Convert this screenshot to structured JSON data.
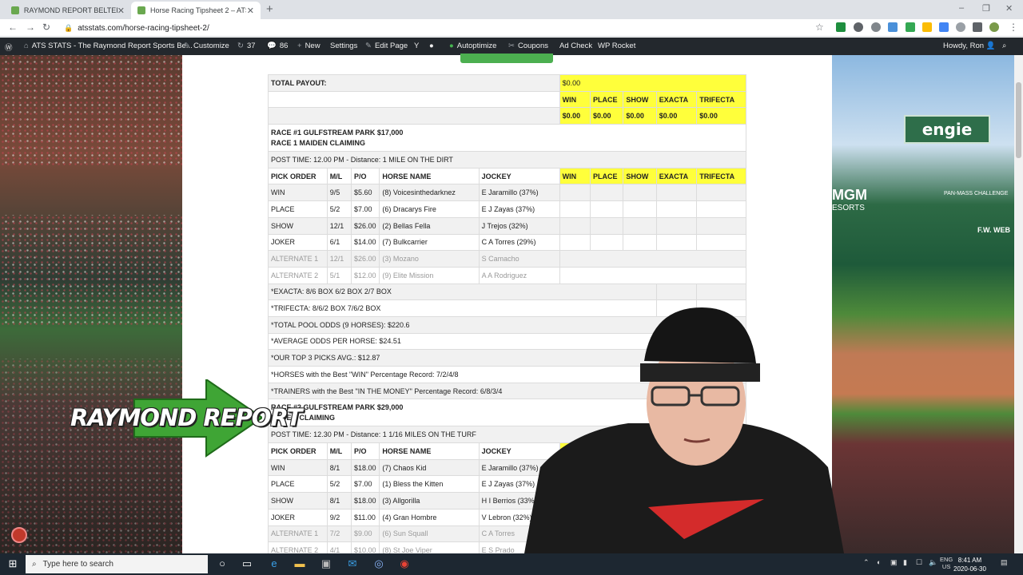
{
  "browser": {
    "tabs": [
      {
        "title": "RAYMOND REPORT BELTERRA PA",
        "active": false
      },
      {
        "title": "Horse Racing Tipsheet 2 – ATS ST",
        "active": true
      }
    ],
    "new_tab_label": "+",
    "url": "atsstats.com/horse-racing-tipsheet-2/",
    "nav_icons": [
      "back-icon",
      "forward-icon",
      "reload-icon",
      "lock-icon"
    ]
  },
  "wp_admin": {
    "site": "ATS STATS - The Raymond Report Sports Be...",
    "customize": "Customize",
    "updates": "37",
    "comments": "86",
    "new": "New",
    "settings": "Settings",
    "edit_page": "Edit Page",
    "autoptimize": "Autoptimize",
    "coupons": "Coupons",
    "ad_check": "Ad Check",
    "wp_rocket": "WP Rocket",
    "howdy": "Howdy, Ron"
  },
  "tipsheet": {
    "total_payout_label": "TOTAL PAYOUT:",
    "total_payout_value": "$0.00",
    "bet_types": [
      "WIN",
      "PLACE",
      "SHOW",
      "EXACTA",
      "TRIFECTA"
    ],
    "bet_totals": [
      "$0.00",
      "$0.00",
      "$0.00",
      "$0.00",
      "$0.00"
    ],
    "col_headers": [
      "PICK ORDER",
      "M/L",
      "P/O",
      "HORSE NAME",
      "JOCKEY"
    ],
    "race1": {
      "title": "RACE #1 GULFSTREAM PARK $17,000",
      "subtitle": "RACE 1 MAIDEN CLAIMING",
      "post_time": "POST TIME: 12.00 PM - Distance: 1 MILE ON THE DIRT",
      "picks": [
        {
          "order": "WIN",
          "ml": "9/5",
          "po": "$5.60",
          "horse": "(8) Voicesinthedarknez",
          "jockey": "E Jaramillo (37%)"
        },
        {
          "order": "PLACE",
          "ml": "5/2",
          "po": "$7.00",
          "horse": "(6) Dracarys Fire",
          "jockey": "E J Zayas (37%)"
        },
        {
          "order": "SHOW",
          "ml": "12/1",
          "po": "$26.00",
          "horse": "(2) Bellas Fella",
          "jockey": "J Trejos (32%)"
        },
        {
          "order": "JOKER",
          "ml": "6/1",
          "po": "$14.00",
          "horse": "(7) Bulkcarrier",
          "jockey": "C A Torres (29%)"
        }
      ],
      "alternates": [
        {
          "order": "ALTERNATE 1",
          "ml": "12/1",
          "po": "$26.00",
          "horse": "(3) Mozano",
          "jockey": "S Camacho"
        },
        {
          "order": "ALTERNATE 2",
          "ml": "5/1",
          "po": "$12.00",
          "horse": "(9) Elite Mission",
          "jockey": "A A Rodriguez"
        }
      ],
      "notes": [
        "*EXACTA: 8/6 BOX 6/2 BOX 2/7 BOX",
        "*TRIFECTA: 8/6/2 BOX 7/6/2 BOX",
        "*TOTAL POOL ODDS (9 HORSES): $220.6",
        "*AVERAGE ODDS PER HORSE: $24.51",
        "*OUR TOP 3 PICKS AVG.: $12.87",
        "*HORSES with the Best \"WIN\" Percentage Record: 7/2/4/8",
        "*TRAINERS with the Best \"IN THE MONEY\" Percentage Record: 6/8/3/4"
      ]
    },
    "race2": {
      "title": "RACE #2 GULFSTREAM PARK $29,000",
      "subtitle": "RACE 2 CLAIMING",
      "post_time": "POST TIME: 12.30 PM - Distance: 1 1/16 MILES ON THE TURF",
      "win_header": "WIN",
      "picks": [
        {
          "order": "WIN",
          "ml": "8/1",
          "po": "$18.00",
          "horse": "(7) Chaos Kid",
          "jockey": "E Jaramillo (37%)"
        },
        {
          "order": "PLACE",
          "ml": "5/2",
          "po": "$7.00",
          "horse": "(1) Bless the Kitten",
          "jockey": "E J Zayas (37%)"
        },
        {
          "order": "SHOW",
          "ml": "8/1",
          "po": "$18.00",
          "horse": "(3) Allgorilla",
          "jockey": "H I Berrios (33%)"
        },
        {
          "order": "JOKER",
          "ml": "9/2",
          "po": "$11.00",
          "horse": "(4) Gran Hombre",
          "jockey": "V Lebron (32%)"
        }
      ],
      "alternates": [
        {
          "order": "ALTERNATE 1",
          "ml": "7/2",
          "po": "$9.00",
          "horse": "(6) Sun Squall",
          "jockey": "C A Torres"
        },
        {
          "order": "ALTERNATE 2",
          "ml": "4/1",
          "po": "$10.00",
          "horse": "(8) St Joe Viper",
          "jockey": "E S Prado"
        }
      ]
    }
  },
  "overlay": {
    "logo_text": "RAYMOND REPORT",
    "stadium_sign": "engie",
    "mgm": "MGM",
    "mgm_sub": "ESORTS",
    "pan_mass": "PAN-MASS CHALLENGE",
    "fw_web": "F.W. WEB"
  },
  "taskbar": {
    "search_placeholder": "Type here to search",
    "lang": "ENG",
    "region": "US",
    "time": "8:41 AM",
    "date": "2020-06-30"
  },
  "colors": {
    "highlight": "#ffff3b",
    "wpbar": "#23282d",
    "taskbar": "#1d2731",
    "green_button": "#4caf50"
  }
}
